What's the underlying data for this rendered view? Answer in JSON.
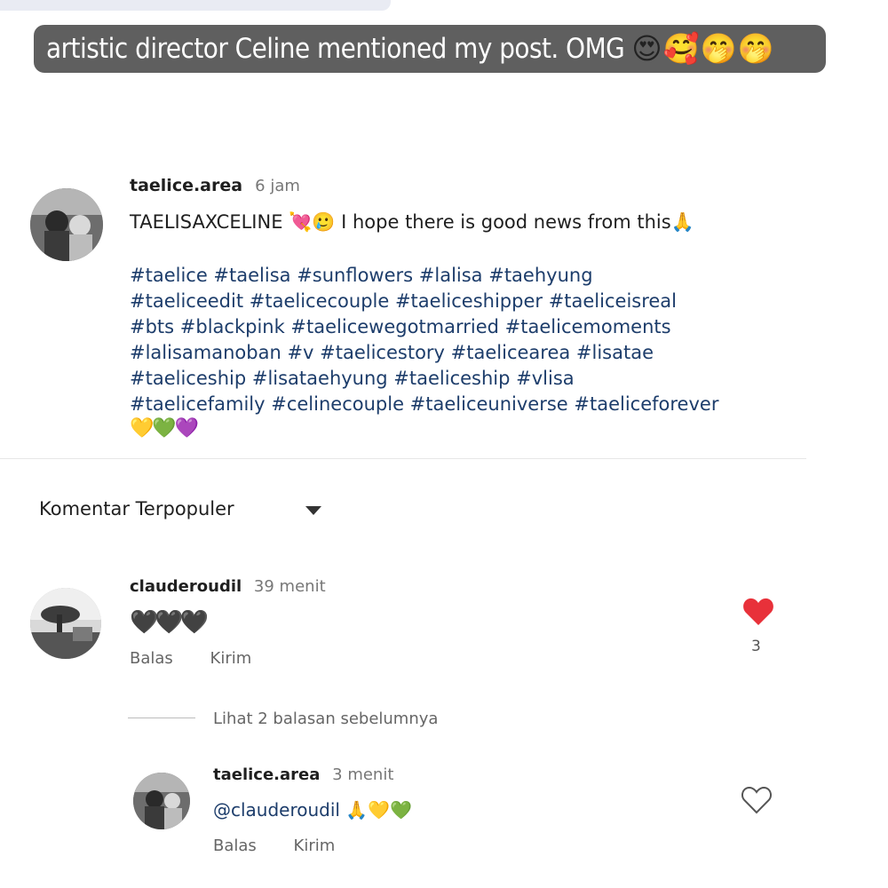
{
  "story": {
    "text": "artistic director Celine mentioned my post. OMG",
    "emojis": "😍🥰🤭🤭"
  },
  "post": {
    "username": "taelice.area",
    "time": "6 jam",
    "caption": "TAELISAXCELINE 💘🥲 I hope there is good news from this🙏",
    "hashtags": [
      "#taelice #taelisa #sunflowers #lalisa #taehyung",
      "#taeliceedit #taelicecouple #taeliceshipper #taeliceisreal",
      "#bts #blackpink #taelicewegotmarried #taelicemoments",
      "#lalisamanoban #v #taelicestory #taelicearea #lisatae",
      "#taeliceship  #lisataehyung #taeliceship #vlisa",
      "#taelicefamily #celinecouple #taeliceuniverse #taeliceforever"
    ],
    "hearts": "💛💚💜"
  },
  "comments_sort": {
    "label": "Komentar Terpopuler"
  },
  "comment1": {
    "username": "clauderoudil",
    "time": "39 menit",
    "text": "🖤🖤🖤",
    "reply_label": "Balas",
    "send_label": "Kirim",
    "like_count": "3"
  },
  "view_replies": "Lihat 2 balasan sebelumnya",
  "reply1": {
    "username": "taelice.area",
    "time": "3 menit",
    "text": "@clauderoudil 🙏💛💚",
    "reply_label": "Balas",
    "send_label": "Kirim"
  },
  "colors": {
    "banner_bg": "#5f5f5f",
    "hashtag": "#1d3d6b",
    "like_red": "#e8313a"
  }
}
